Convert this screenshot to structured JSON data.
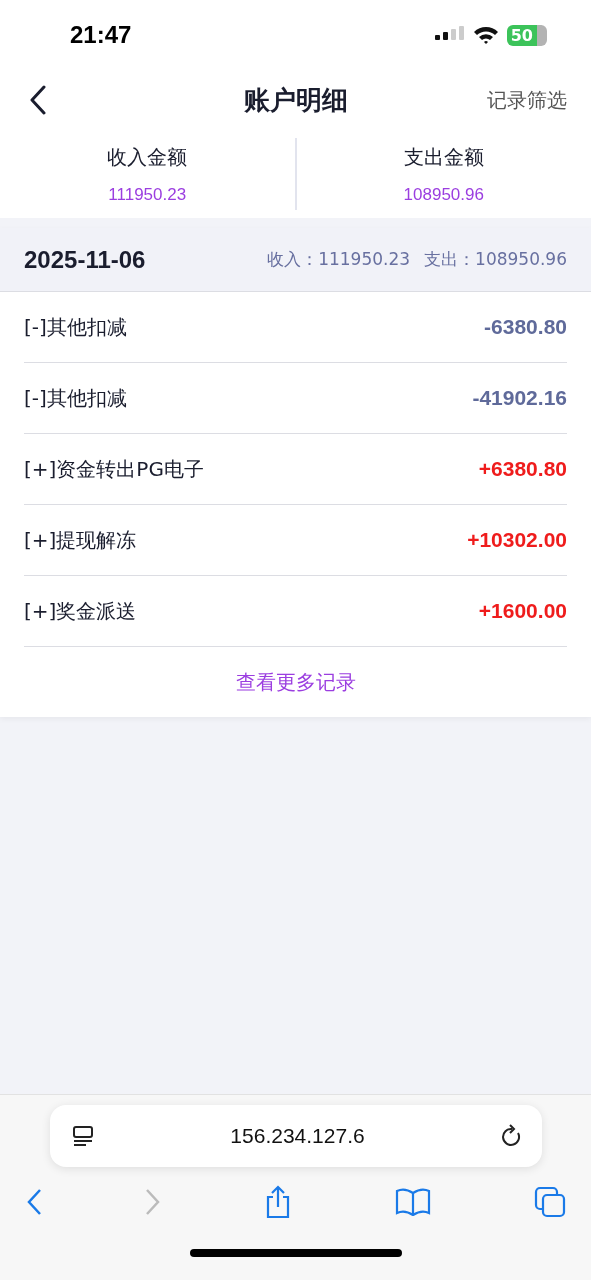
{
  "status_bar": {
    "time": "21:47",
    "battery": "50"
  },
  "nav": {
    "title": "账户明细",
    "action": "记录筛选"
  },
  "summary": [
    {
      "label": "收入金额",
      "value": "111950.23"
    },
    {
      "label": "支出金额",
      "value": "108950.96"
    }
  ],
  "day": {
    "date": "2025-11-06",
    "income": "收入：111950.23",
    "expense": "支出：108950.96"
  },
  "records": [
    {
      "kind": "minus",
      "name": "[-]其他扣减",
      "amount": "-6380.80"
    },
    {
      "kind": "minus",
      "name": "[-]其他扣减",
      "amount": "-41902.16"
    },
    {
      "kind": "plus",
      "name": "[+]资金转出PG电子",
      "amount": "+6380.80"
    },
    {
      "kind": "plus",
      "name": "[+]提现解冻",
      "amount": "+10302.00"
    },
    {
      "kind": "plus",
      "name": "[+]奖金派送",
      "amount": "+1600.00"
    }
  ],
  "more_link": "查看更多记录",
  "browser": {
    "address": "156.234.127.6",
    "forward_disabled": true
  }
}
